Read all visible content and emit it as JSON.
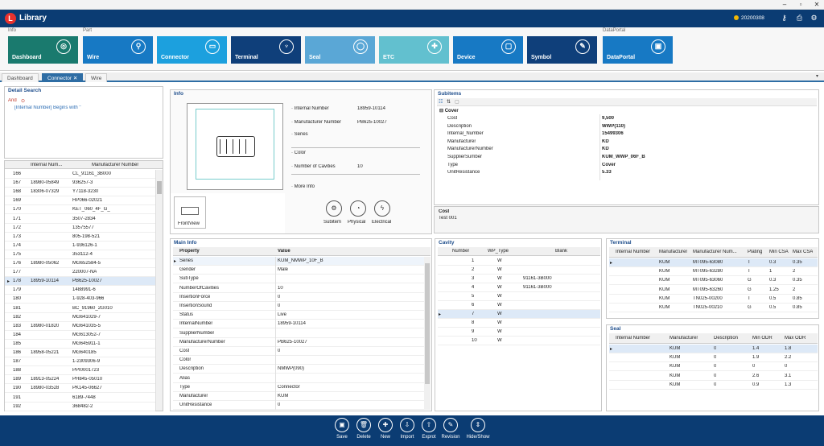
{
  "window": {
    "minimize": "–",
    "maximize": "▫",
    "close": "✕"
  },
  "app": {
    "title": "Library",
    "user": "20200308"
  },
  "ribbon": {
    "groups": [
      {
        "label": "Info"
      },
      {
        "label": "Part"
      },
      {
        "label": "DataPortal"
      }
    ],
    "tiles": [
      {
        "label": "Dashboard",
        "color": "#1a7a6e",
        "icon": "◎"
      },
      {
        "label": "Wire",
        "color": "#1779c4",
        "icon": "⚲"
      },
      {
        "label": "Connector",
        "color": "#1ca0de",
        "icon": "▭"
      },
      {
        "label": "Terminal",
        "color": "#0f3f7a",
        "icon": "♆"
      },
      {
        "label": "Seal",
        "color": "#5aa7d6",
        "icon": "◯"
      },
      {
        "label": "ETC",
        "color": "#62c0cf",
        "icon": "✚"
      },
      {
        "label": "Device",
        "color": "#1779c4",
        "icon": "▢"
      },
      {
        "label": "Symbol",
        "color": "#0f3f7a",
        "icon": "✎"
      },
      {
        "label": "DataPortal",
        "color": "#1779c4",
        "icon": "▣"
      }
    ]
  },
  "doctabs": [
    {
      "label": "Dashboard"
    },
    {
      "label": "Connector",
      "close": "✕"
    },
    {
      "label": "Wire"
    }
  ],
  "detail_search": {
    "title": "Detail Search",
    "and": "And",
    "condition": "[Internal Number] Begins with ''"
  },
  "list": {
    "headers": [
      "Internal Num...",
      "Manufacturer Number"
    ],
    "rows": [
      {
        "n": "166",
        "i": "",
        "m": "CL_91161_3B000"
      },
      {
        "n": "167",
        "i": "18980-05849",
        "m": "936257-3"
      },
      {
        "n": "168",
        "i": "18306-07329",
        "m": "Y7118-3230"
      },
      {
        "n": "169",
        "i": "",
        "m": "HP066-02021"
      },
      {
        "n": "170",
        "i": "",
        "m": "KET_060_4F_G_"
      },
      {
        "n": "171",
        "i": "",
        "m": "3507-2834"
      },
      {
        "n": "172",
        "i": "",
        "m": "13575577"
      },
      {
        "n": "173",
        "i": "",
        "m": "805-198-521"
      },
      {
        "n": "174",
        "i": "",
        "m": "1-936126-1"
      },
      {
        "n": "175",
        "i": "",
        "m": "353112-4"
      },
      {
        "n": "176",
        "i": "18980-05062",
        "m": "MG652584-5"
      },
      {
        "n": "177",
        "i": "",
        "m": "220007-NA"
      },
      {
        "n": "178",
        "i": "18959-10114",
        "m": "PB625-10027"
      },
      {
        "n": "179",
        "i": "",
        "m": "1488991-6"
      },
      {
        "n": "180",
        "i": "",
        "m": "1-928-403-966"
      },
      {
        "n": "181",
        "i": "",
        "m": "BC_91960_2G010"
      },
      {
        "n": "182",
        "i": "",
        "m": "MG641029-7"
      },
      {
        "n": "183",
        "i": "18980-01820",
        "m": "MG641035-5"
      },
      {
        "n": "184",
        "i": "",
        "m": "MG613052-7"
      },
      {
        "n": "185",
        "i": "",
        "m": "MG645911-1"
      },
      {
        "n": "186",
        "i": "18958-05221",
        "m": "MG640185"
      },
      {
        "n": "187",
        "i": "",
        "m": "1-2309306-9"
      },
      {
        "n": "188",
        "i": "",
        "m": "PPI0001723"
      },
      {
        "n": "189",
        "i": "18913-05224",
        "m": "PH845-05010"
      },
      {
        "n": "190",
        "i": "18980-03528",
        "m": "PK145-06627"
      },
      {
        "n": "191",
        "i": "",
        "m": "6189-7448"
      },
      {
        "n": "192",
        "i": "",
        "m": "368482-2"
      }
    ]
  },
  "info": {
    "title": "Info",
    "fields": [
      {
        "label": "· Internal Number",
        "value": "18959-10114"
      },
      {
        "label": "· Manufacturer Number",
        "value": "PB625-10027"
      },
      {
        "label": "· Series",
        "value": ""
      },
      {
        "label": "· Color",
        "value": ""
      },
      {
        "label": "· Number of Cavities",
        "value": "10"
      },
      {
        "label": "· More Info",
        "value": ""
      }
    ],
    "view_label": "FrontView",
    "buttons": [
      {
        "label": "Subitem",
        "icon": "⚙"
      },
      {
        "label": "Physical",
        "icon": "◔"
      },
      {
        "label": "Electrical",
        "icon": "ϟ"
      }
    ]
  },
  "subitems": {
    "title": "Subitems",
    "group": "Cover",
    "rows": [
      {
        "k": "Cost",
        "v": "9,500"
      },
      {
        "k": "Description",
        "v": "WWP(110)"
      },
      {
        "k": "Internal_Number",
        "v": "15499306"
      },
      {
        "k": "Manufacturer",
        "v": "KD"
      },
      {
        "k": "ManufacturerNumber",
        "v": "KD"
      },
      {
        "k": "SupplierSumber",
        "v": "KUM_WWP_06F_B"
      },
      {
        "k": "Type",
        "v": "Cover"
      },
      {
        "k": "UnitResistance",
        "v": "5.33"
      }
    ],
    "desc_title": "Cost",
    "desc_text": "Test 001"
  },
  "main_info": {
    "title": "Main Info",
    "headers": [
      "Property",
      "Value"
    ],
    "rows": [
      {
        "k": "Series",
        "v": "KUM_NMWP_10F_B"
      },
      {
        "k": "Gender",
        "v": "Male"
      },
      {
        "k": "SubType",
        "v": ""
      },
      {
        "k": "NumberOfCavities",
        "v": "10"
      },
      {
        "k": "InsertionForce",
        "v": "0"
      },
      {
        "k": "InsertionSound",
        "v": "0"
      },
      {
        "k": "Status",
        "v": "Live"
      },
      {
        "k": "InternalNumber",
        "v": "18959-10114"
      },
      {
        "k": "SupplierNumber",
        "v": ""
      },
      {
        "k": "ManufacturerNumber",
        "v": "PB625-10027"
      },
      {
        "k": "Cost",
        "v": "0"
      },
      {
        "k": "Color",
        "v": ""
      },
      {
        "k": "Description",
        "v": "NMWP(090)"
      },
      {
        "k": "Alias",
        "v": ""
      },
      {
        "k": "Type",
        "v": "Connector"
      },
      {
        "k": "Manufacturer",
        "v": "KUM"
      },
      {
        "k": "UnitResistance",
        "v": "0"
      }
    ]
  },
  "cavity": {
    "title": "Cavity",
    "headers": [
      "Number",
      "WP_Type",
      "Blank"
    ],
    "rows": [
      {
        "n": "1",
        "w": "W",
        "b": ""
      },
      {
        "n": "2",
        "w": "W",
        "b": ""
      },
      {
        "n": "3",
        "w": "W",
        "b": "91161-3B000"
      },
      {
        "n": "4",
        "w": "W",
        "b": "91161-3B000"
      },
      {
        "n": "5",
        "w": "W",
        "b": ""
      },
      {
        "n": "6",
        "w": "W",
        "b": ""
      },
      {
        "n": "7",
        "w": "W",
        "b": ""
      },
      {
        "n": "8",
        "w": "W",
        "b": ""
      },
      {
        "n": "9",
        "w": "W",
        "b": ""
      },
      {
        "n": "10",
        "w": "W",
        "b": ""
      }
    ]
  },
  "terminal": {
    "title": "Terminal",
    "headers": [
      "Internal Number",
      "Manufacturer",
      "Manufacturer Num...",
      "Plating",
      "Min CSA",
      "Max CSA"
    ],
    "rows": [
      {
        "a": "",
        "b": "KUM",
        "c": "MT095-63080",
        "d": "T",
        "e": "0.3",
        "f": "0.35"
      },
      {
        "a": "",
        "b": "KUM",
        "c": "MT095-63280",
        "d": "T",
        "e": "1",
        "f": "2"
      },
      {
        "a": "",
        "b": "KUM",
        "c": "MT095-63060",
        "d": "G",
        "e": "0.3",
        "f": "0.35"
      },
      {
        "a": "",
        "b": "KUM",
        "c": "MT095-63260",
        "d": "G",
        "e": "1.25",
        "f": "2"
      },
      {
        "a": "",
        "b": "KUM",
        "c": "TN025-00200",
        "d": "T",
        "e": "0.5",
        "f": "0.85"
      },
      {
        "a": "",
        "b": "KUM",
        "c": "TN025-00210",
        "d": "G",
        "e": "0.5",
        "f": "0.85"
      }
    ]
  },
  "seal": {
    "title": "Seal",
    "headers": [
      "Internal Number",
      "Manufacturer",
      "Description",
      "Min ODR",
      "Max ODR"
    ],
    "rows": [
      {
        "a": "",
        "b": "KUM",
        "c": "0",
        "d": "1.4",
        "e": "1.8"
      },
      {
        "a": "",
        "b": "KUM",
        "c": "0",
        "d": "1.9",
        "e": "2.2"
      },
      {
        "a": "",
        "b": "KUM",
        "c": "0",
        "d": "0",
        "e": "0"
      },
      {
        "a": "",
        "b": "KUM",
        "c": "0",
        "d": "2.6",
        "e": "3.1"
      },
      {
        "a": "",
        "b": "KUM",
        "c": "0",
        "d": "0.9",
        "e": "1.3"
      }
    ]
  },
  "actions": [
    {
      "label": "Save",
      "icon": "▣"
    },
    {
      "label": "Delete",
      "icon": "🗑"
    },
    {
      "label": "New",
      "icon": "✚"
    },
    {
      "label": "Import",
      "icon": "⇩"
    },
    {
      "label": "Exprot",
      "icon": "⇧"
    },
    {
      "label": "Revision",
      "icon": "✎"
    },
    {
      "label": "Hide/Show",
      "icon": "⇕"
    }
  ]
}
